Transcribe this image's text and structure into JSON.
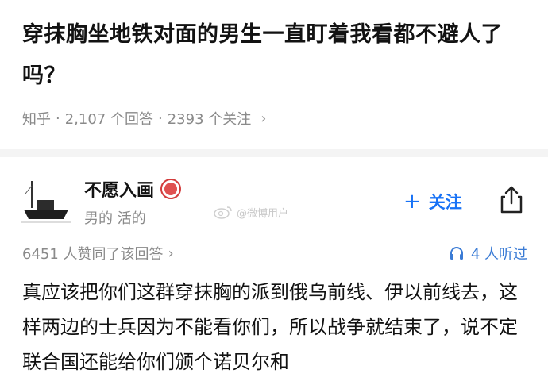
{
  "question": {
    "title": "穿抹胸坐地铁对面的男生一直盯着我看都不避人了吗？",
    "source": "知乎",
    "answers_text": "2,107 个回答",
    "followers_text": "2393 个关注",
    "separator": "·",
    "chevron": "›"
  },
  "author": {
    "name": "不愿入画",
    "bio": "男的 活的",
    "badge_icon": "badge-icon",
    "avatar_icon": "boat-avatar"
  },
  "watermark": {
    "text": "@微博用户"
  },
  "actions": {
    "follow_plus": "+",
    "follow_label": "关注",
    "share_icon": "share-icon"
  },
  "stats": {
    "votes_text": "6451 人赞同了该回答",
    "chevron": "›",
    "listen_text": "4 人听过",
    "listen_icon": "headphones-icon"
  },
  "answer": {
    "text": "真应该把你们这群穿抹胸的派到俄乌前线、伊以前线去，这样两边的士兵因为不能看你们，所以战争就结束了，说不定联合国还能给你们颁个诺贝尔和"
  },
  "colors": {
    "accent": "#1772f6",
    "muted": "#8a8a8a",
    "badge": "#d23b3b"
  }
}
